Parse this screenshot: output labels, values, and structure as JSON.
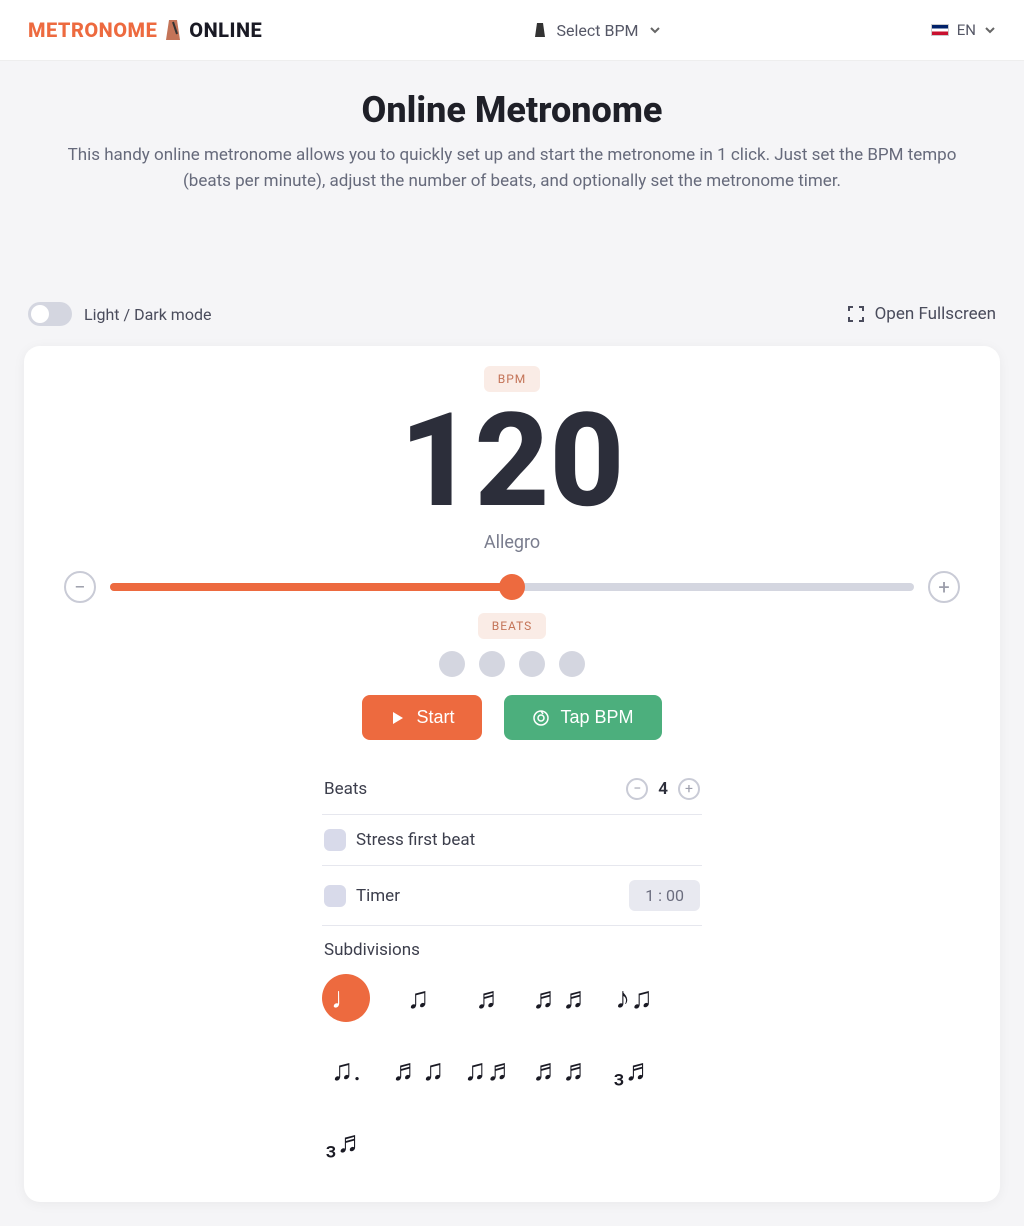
{
  "header": {
    "logo_part1": "METRONOME",
    "logo_part2": "ONLINE",
    "select_bpm": "Select BPM",
    "lang": "EN"
  },
  "hero": {
    "title": "Online Metronome",
    "description": "This handy online metronome allows you to quickly set up and start the metronome in 1 click. Just set the BPM tempo (beats per minute), adjust the number of beats, and optionally set the metronome timer."
  },
  "mode": {
    "label": "Light / Dark mode",
    "fullscreen": "Open Fullscreen"
  },
  "metronome": {
    "bpm_badge": "BPM",
    "bpm_value": "120",
    "tempo_name": "Allegro",
    "slider_percent": 50,
    "beats_badge": "BEATS",
    "beat_count": 4,
    "start_label": "Start",
    "tap_label": "Tap BPM"
  },
  "settings": {
    "beats_label": "Beats",
    "beats_value": "4",
    "stress_label": "Stress first beat",
    "timer_label": "Timer",
    "timer_value": "1 : 00",
    "subdivisions_label": "Subdivisions",
    "sub_items": [
      "♩",
      "♫",
      "♬",
      "♬♬",
      "♪♫",
      "♫.",
      "♬♫",
      "♫♬",
      "♬♬",
      "₃♬",
      "₃♬"
    ]
  }
}
